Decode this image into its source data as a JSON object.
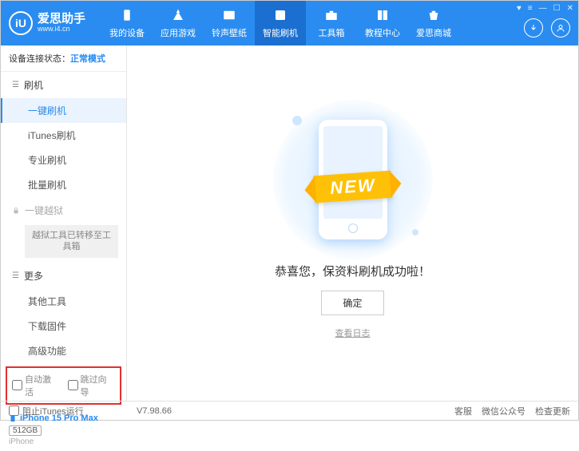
{
  "header": {
    "logo_main": "爱思助手",
    "logo_sub": "www.i4.cn",
    "logo_mark": "iU",
    "nav": [
      {
        "label": "我的设备"
      },
      {
        "label": "应用游戏"
      },
      {
        "label": "铃声壁纸"
      },
      {
        "label": "智能刷机"
      },
      {
        "label": "工具箱"
      },
      {
        "label": "教程中心"
      },
      {
        "label": "爱思商城"
      }
    ]
  },
  "sidebar": {
    "status_label": "设备连接状态：",
    "status_value": "正常模式",
    "section_flash": "刷机",
    "items_flash": [
      "一键刷机",
      "iTunes刷机",
      "专业刷机",
      "批量刷机"
    ],
    "jailbreak": "一键越狱",
    "jailbreak_note": "越狱工具已转移至工具箱",
    "section_more": "更多",
    "items_more": [
      "其他工具",
      "下载固件",
      "高级功能"
    ],
    "cb_auto_activate": "自动激活",
    "cb_skip_guide": "跳过向导",
    "device_name": "iPhone 15 Pro Max",
    "device_capacity": "512GB",
    "device_brand": "iPhone"
  },
  "main": {
    "ribbon": "NEW",
    "success_text": "恭喜您，保资料刷机成功啦！",
    "ok_button": "确定",
    "view_log": "查看日志"
  },
  "footer": {
    "block_itunes": "阻止iTunes运行",
    "version": "V7.98.66",
    "links": [
      "客服",
      "微信公众号",
      "检查更新"
    ]
  }
}
